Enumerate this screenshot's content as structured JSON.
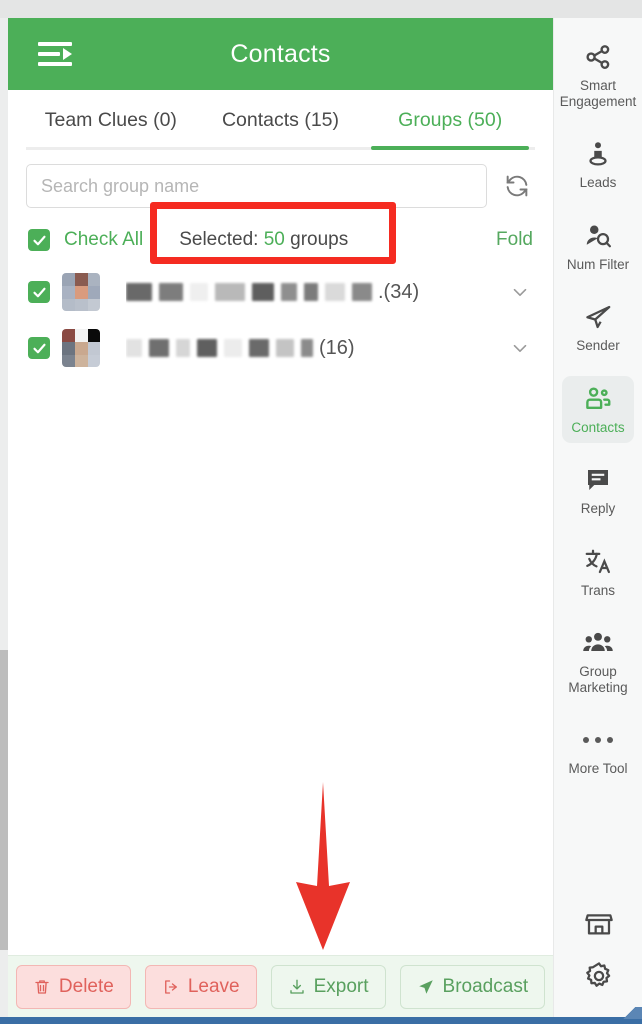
{
  "header": {
    "title": "Contacts",
    "menu_icon": "menu-arrow-icon"
  },
  "tabs": [
    {
      "label": "Team Clues (0)",
      "active": false
    },
    {
      "label": "Contacts (15)",
      "active": false
    },
    {
      "label": "Groups (50)",
      "active": true
    }
  ],
  "search": {
    "placeholder": "Search group name",
    "value": "",
    "refresh_icon": "refresh-icon"
  },
  "select_bar": {
    "check_all_label": "Check All",
    "checked": true,
    "selected_prefix": "Selected: ",
    "selected_count": "50",
    "selected_suffix": " groups",
    "fold_label": "Fold"
  },
  "groups": [
    {
      "name_redacted": true,
      "member_count": ".(34)",
      "checked": true
    },
    {
      "name_redacted": true,
      "member_count": "(16)",
      "checked": true
    }
  ],
  "actions": [
    {
      "label": "Delete",
      "icon": "trash-icon",
      "style": "danger"
    },
    {
      "label": "Leave",
      "icon": "logout-icon",
      "style": "danger"
    },
    {
      "label": "Export",
      "icon": "download-icon",
      "style": "ghost"
    },
    {
      "label": "Broadcast",
      "icon": "send-icon",
      "style": "ghost"
    }
  ],
  "sidebar": {
    "items": [
      {
        "label": "Smart\nEngagement",
        "icon": "share-nodes-icon",
        "active": false
      },
      {
        "label": "Leads",
        "icon": "person-target-icon",
        "active": false
      },
      {
        "label": "Num Filter",
        "icon": "person-search-icon",
        "active": false
      },
      {
        "label": "Sender",
        "icon": "paper-plane-icon",
        "active": false
      },
      {
        "label": "Contacts",
        "icon": "contacts-icon",
        "active": true
      },
      {
        "label": "Reply",
        "icon": "chat-bubble-icon",
        "active": false
      },
      {
        "label": "Trans",
        "icon": "translate-icon",
        "active": false
      },
      {
        "label": "Group\nMarketing",
        "icon": "group-people-icon",
        "active": false
      },
      {
        "label": "More Tool",
        "icon": "ellipsis-icon",
        "active": false
      }
    ],
    "bottom_items": [
      {
        "icon": "store-icon"
      },
      {
        "icon": "gear-icon"
      }
    ]
  },
  "annotations": {
    "highlight_box_color": "#f52b21",
    "arrow_color": "#e8332a",
    "arrow_target": "Export"
  },
  "colors": {
    "brand_green": "#4caf58",
    "header_green": "#4caf58",
    "danger_red": "#e0625c",
    "panel_bg": "#ffffff",
    "rail_bg": "#f7f8f8",
    "action_bar_bg": "#eef7ee"
  }
}
